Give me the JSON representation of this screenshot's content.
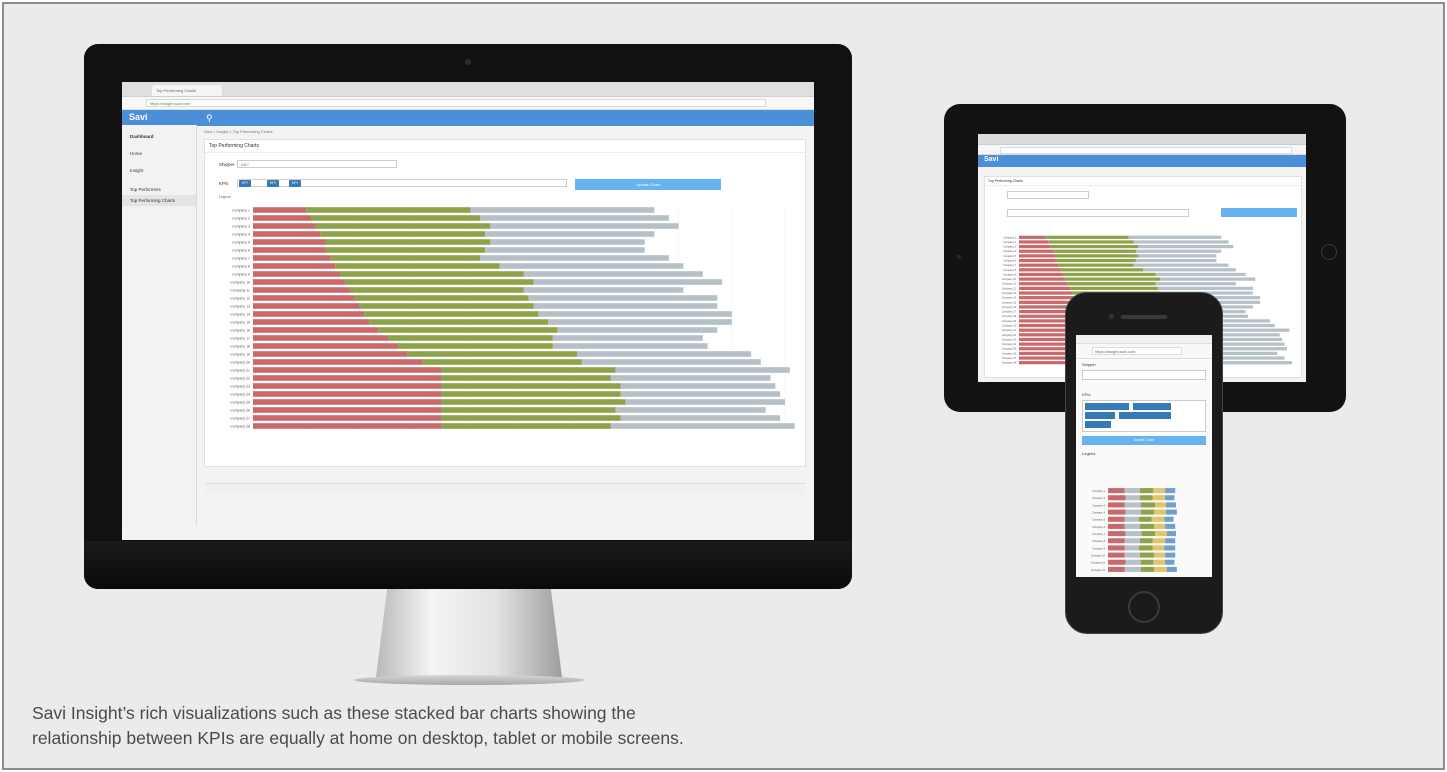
{
  "caption": {
    "line1": "Savi Insight’s rich visualizations such as these stacked bar charts showing the",
    "line2": "relationship between KPIs are equally at home on desktop, tablet or mobile screens."
  },
  "desktop": {
    "browser_tab": "Top Performing Charts",
    "url": "https://insight.savi.com",
    "app_logo": "Savi",
    "sidebar": [
      {
        "label": "Dashboard"
      },
      {
        "label": "Home"
      },
      {
        "label": "Insight"
      },
      {
        "label": "Top Performers"
      },
      {
        "label": "Top Performing Charts"
      }
    ],
    "breadcrumb": "Savi > Insight > Top Performing Charts",
    "panel_title": "Top Performing Charts",
    "shipper_label": "Shipper",
    "shipper_value": "ABC",
    "kpi_label": "KPIs",
    "kpi_chips": [
      "KPI",
      "KPI",
      "KPI"
    ],
    "update_button": "Update Chart",
    "legend_label": "Legend"
  },
  "colors": {
    "header": "#4a8fd8",
    "series_red": "#c9696b",
    "series_green": "#8da34a",
    "series_gray": "#b6c1c7",
    "series_yellow": "#e0c56a",
    "series_blue": "#6f9fd0"
  },
  "chart_data": {
    "type": "bar",
    "title": "",
    "categories": [
      "Company 1",
      "Company 2",
      "Company 3",
      "Company 4",
      "Company 5",
      "Company 6",
      "Company 7",
      "Company 8",
      "Company 9",
      "Company 10",
      "Company 11",
      "Company 12",
      "Company 13",
      "Company 14",
      "Company 15",
      "Company 16",
      "Company 17",
      "Company 18",
      "Company 19",
      "Company 20",
      "Company 21",
      "Company 22",
      "Company 23",
      "Company 24",
      "Company 25",
      "Company 26",
      "Company 27",
      "Company 28"
    ],
    "series": [
      {
        "values": [
          1.1,
          1.2,
          1.3,
          1.4,
          1.5,
          1.5,
          1.6,
          1.7,
          1.8,
          1.9,
          2.0,
          2.1,
          2.2,
          2.3,
          2.4,
          2.6,
          2.8,
          3.0,
          3.2,
          3.5,
          3.9,
          3.9,
          3.9,
          3.9,
          3.9,
          3.9,
          3.9,
          3.9
        ]
      },
      {
        "values": [
          3.4,
          3.5,
          3.6,
          3.4,
          3.4,
          3.3,
          3.1,
          3.4,
          3.8,
          3.9,
          3.6,
          3.6,
          3.6,
          3.6,
          3.7,
          3.7,
          3.4,
          3.2,
          3.5,
          3.3,
          3.6,
          3.5,
          3.7,
          3.7,
          3.8,
          3.6,
          3.7,
          3.5
        ]
      },
      {
        "values": [
          3.8,
          3.9,
          3.9,
          3.5,
          3.2,
          3.3,
          3.9,
          3.8,
          3.7,
          3.9,
          3.3,
          3.9,
          3.8,
          4.0,
          3.8,
          3.3,
          3.1,
          3.2,
          3.6,
          3.7,
          3.6,
          3.3,
          3.2,
          3.3,
          3.3,
          3.1,
          3.3,
          3.8
        ]
      }
    ],
    "stacked": true,
    "orientation": "horizontal",
    "xlim": [
      0,
      11
    ]
  },
  "mobile_chart_data": {
    "type": "bar",
    "stacked": true,
    "orientation": "horizontal",
    "categories": [
      "Company 1",
      "Company 2",
      "Company 3",
      "Company 4",
      "Company 5",
      "Company 6",
      "Company 7",
      "Company 8",
      "Company 9",
      "Company 10",
      "Company 11",
      "Company 12"
    ],
    "series": [
      {
        "values": [
          2.0,
          2.1,
          2.0,
          2.1,
          2.0,
          2.0,
          2.1,
          2.0,
          2.0,
          2.0,
          2.1,
          2.0
        ]
      },
      {
        "values": [
          1.8,
          1.7,
          1.9,
          1.8,
          1.7,
          1.8,
          1.9,
          1.8,
          1.7,
          1.8,
          1.8,
          1.9
        ]
      },
      {
        "values": [
          1.6,
          1.5,
          1.7,
          1.6,
          1.5,
          1.7,
          1.6,
          1.5,
          1.6,
          1.7,
          1.5,
          1.6
        ]
      },
      {
        "values": [
          1.4,
          1.5,
          1.3,
          1.4,
          1.5,
          1.3,
          1.4,
          1.5,
          1.4,
          1.3,
          1.4,
          1.5
        ]
      },
      {
        "values": [
          1.2,
          1.1,
          1.2,
          1.3,
          1.1,
          1.2,
          1.1,
          1.2,
          1.3,
          1.2,
          1.1,
          1.2
        ]
      }
    ]
  }
}
